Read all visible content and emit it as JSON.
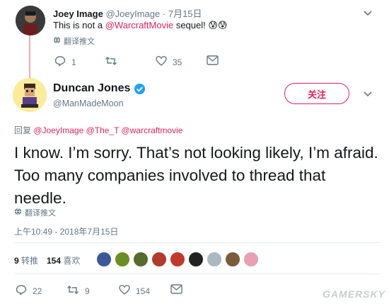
{
  "reply_tweet": {
    "name": "Joey Image",
    "handle": "@JoeyImage",
    "separator": "·",
    "date": "7月15日",
    "text_prefix": "This is not a ",
    "mention": "@WarcraftMovie",
    "text_suffix": " sequel! 😰😰",
    "translate_label": "翻译推文",
    "reply_count": "1",
    "like_count": "35"
  },
  "main_tweet": {
    "name": "Duncan Jones",
    "handle": "@ManMadeMoon",
    "follow_label": "关注",
    "reply_to_label": "回复",
    "reply_to_handles": "@JoeyImage @The_T @warcraftmovie",
    "text": "I know.  I’m sorry.  That’s not looking likely, I’m afraid.  Too many companies involved to thread that needle.",
    "translate_label": "翻译推文",
    "timestamp": "上午10:49 - 2018年7月15日",
    "retweets_count": "9",
    "retweets_label": "转推",
    "likes_count": "154",
    "likes_label": "喜欢",
    "reply_count": "22",
    "retweet_count": "9",
    "like_count": "154"
  },
  "likers": [
    {
      "name": "liker-1",
      "color": "#3b5998"
    },
    {
      "name": "liker-2",
      "color": "#6b8e23"
    },
    {
      "name": "liker-3",
      "color": "#556b2f"
    },
    {
      "name": "liker-4",
      "color": "#b03a2e"
    },
    {
      "name": "liker-5",
      "color": "#c0392b"
    },
    {
      "name": "liker-6",
      "color": "#222222"
    },
    {
      "name": "liker-7",
      "color": "#aab8c2"
    },
    {
      "name": "liker-8",
      "color": "#7a5c3a"
    },
    {
      "name": "liker-9",
      "color": "#e8a0b4"
    }
  ],
  "watermark": "GAMERSKY",
  "colors": {
    "accent": "#e0245e",
    "verified": "#1da1f2",
    "muted": "#657786"
  }
}
